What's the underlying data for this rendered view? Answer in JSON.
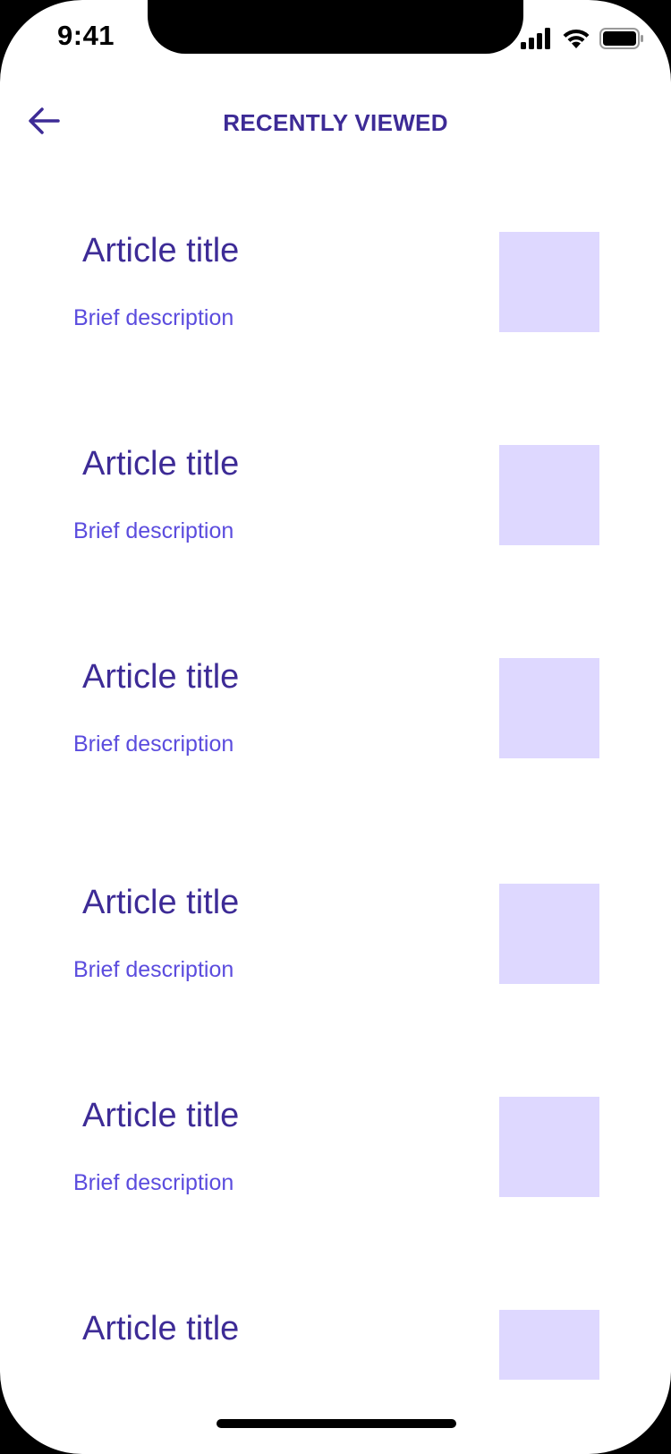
{
  "status_bar": {
    "time": "9:41",
    "signal_icon": "cellular-signal-icon",
    "wifi_icon": "wifi-icon",
    "battery_icon": "battery-icon"
  },
  "header": {
    "back_icon": "arrow-left-icon",
    "title": "RECENTLY VIEWED"
  },
  "articles": [
    {
      "title": "Article title",
      "description": "Brief description"
    },
    {
      "title": "Article title",
      "description": "Brief description"
    },
    {
      "title": "Article title",
      "description": "Brief description"
    },
    {
      "title": "Article title",
      "description": "Brief description"
    },
    {
      "title": "Article title",
      "description": "Brief description"
    },
    {
      "title": "Article title",
      "description": ""
    }
  ],
  "colors": {
    "accent_dark": "#3d2b96",
    "accent": "#5b4cde",
    "thumbnail": "#ded8ff"
  }
}
